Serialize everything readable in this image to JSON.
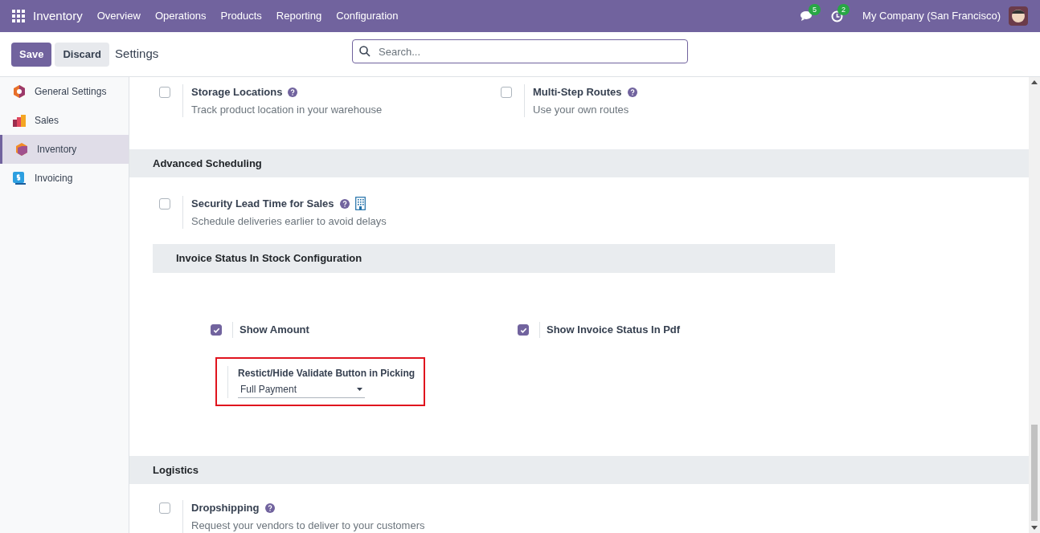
{
  "navbar": {
    "app": "Inventory",
    "menu": [
      "Overview",
      "Operations",
      "Products",
      "Reporting",
      "Configuration"
    ],
    "messages_count": "5",
    "activities_count": "2",
    "company": "My Company (San Francisco)"
  },
  "control_panel": {
    "buttons": [
      "Save",
      "Discard"
    ],
    "title": "Settings",
    "search": {
      "placeholder": "Search..."
    }
  },
  "sidebar": {
    "items": [
      {
        "label": "General Settings",
        "selected": false,
        "kind": "general"
      },
      {
        "label": "Sales",
        "selected": false,
        "kind": "sales"
      },
      {
        "label": "Inventory",
        "selected": true,
        "kind": "inventory"
      },
      {
        "label": "Invoicing",
        "selected": false,
        "kind": "invoicing"
      }
    ]
  },
  "top_settings": [
    {
      "label": "Storage Locations",
      "description": "Track product location in your warehouse",
      "checked": false,
      "company_icon": false
    },
    {
      "label": "Multi-Step Routes",
      "description": "Use your own routes",
      "checked": false,
      "company_icon": false
    }
  ],
  "advanced_scheduling": {
    "title": "Advanced Scheduling",
    "settings": [
      {
        "label": "Security Lead Time for Sales",
        "description": "Schedule deliveries earlier to avoid delays",
        "checked": false,
        "company_icon": true
      }
    ]
  },
  "invoice_status": {
    "title": "Invoice Status In Stock Configuration",
    "options": [
      {
        "label": "Show Amount",
        "checked": true
      },
      {
        "label": "Show Invoice Status In Pdf",
        "checked": true
      }
    ],
    "select": {
      "label": "Restict/Hide Validate Button in Picking",
      "value": "Full Payment"
    }
  },
  "logistics": {
    "title": "Logistics",
    "settings": [
      {
        "label": "Dropshipping",
        "description": "Request your vendors to deliver to your customers",
        "checked": false,
        "company_icon": false
      }
    ]
  }
}
